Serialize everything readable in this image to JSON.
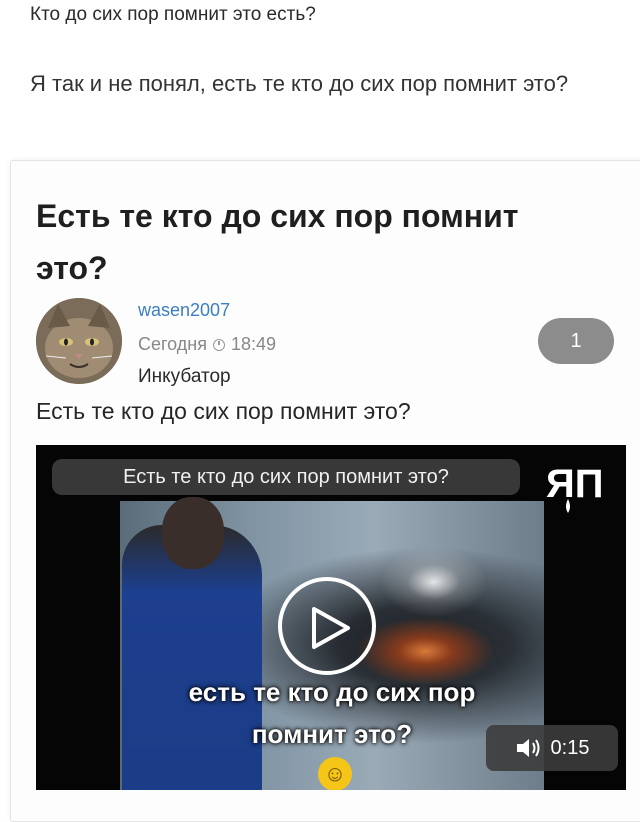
{
  "post": {
    "title": "Кто до сих пор помнит это есть?",
    "body": "Я так и не понял, есть те кто до сих пор помнит это?"
  },
  "embed": {
    "title": "Есть те кто до сих пор помнит это?",
    "author": "wasen2007",
    "date": "Сегодня",
    "time": "18:49",
    "category": "Инкубатор",
    "comment_count": "1",
    "text": "Есть те кто до сих пор помнит это?",
    "video": {
      "caption": "Есть те кто до сих пор помнит это?",
      "logo_text": "ЯП",
      "subtitle": "есть те кто до сих пор помнит это?",
      "duration": "0:15",
      "icons": [
        "play-icon",
        "volume-icon",
        "laughing-emoji-icon",
        "clock-icon"
      ]
    }
  },
  "colors": {
    "author_link": "#3a7fc2",
    "badge_bg": "#8c8c8c",
    "video_bg": "#050505"
  }
}
